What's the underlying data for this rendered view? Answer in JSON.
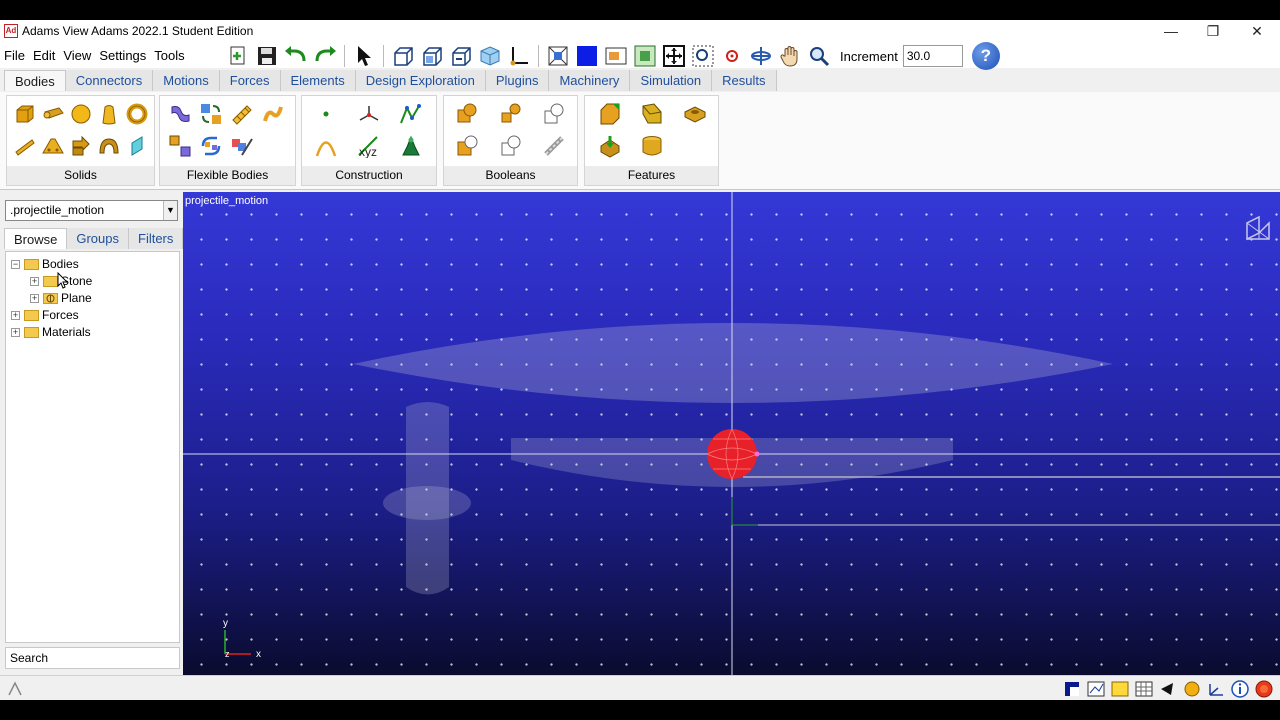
{
  "window": {
    "logo_text": "Ad",
    "title": "Adams  View Adams 2022.1 Student Edition",
    "minimize": "—",
    "maximize": "❐",
    "close": "✕"
  },
  "menus": [
    "File",
    "Edit",
    "View",
    "Settings",
    "Tools"
  ],
  "toolbar": {
    "increment_label": "Increment",
    "increment_value": "30.0",
    "help": "?"
  },
  "ribbon_tabs": [
    "Bodies",
    "Connectors",
    "Motions",
    "Forces",
    "Elements",
    "Design Exploration",
    "Plugins",
    "Machinery",
    "Simulation",
    "Results"
  ],
  "ribbon_groups": {
    "solids": "Solids",
    "flexible": "Flexible Bodies",
    "construction": "Construction",
    "booleans": "Booleans",
    "features": "Features"
  },
  "construction_marker_text": "xyz",
  "left_panel": {
    "model_selector": ".projectile_motion",
    "tabs": [
      "Browse",
      "Groups",
      "Filters"
    ],
    "tree": {
      "bodies": "Bodies",
      "stone": "Stone",
      "plane": "Plane",
      "forces": "Forces",
      "materials": "Materials"
    },
    "search": "Search"
  },
  "viewport": {
    "model_name": "projectile_motion",
    "triad": {
      "y": "y",
      "z": "z",
      "x": "x"
    }
  },
  "colors": {
    "viewport_top": "#3438d6",
    "viewport_bottom": "#0a0b2e",
    "stone": "#e8202a",
    "accent_tab_text": "#1f4f9a"
  }
}
